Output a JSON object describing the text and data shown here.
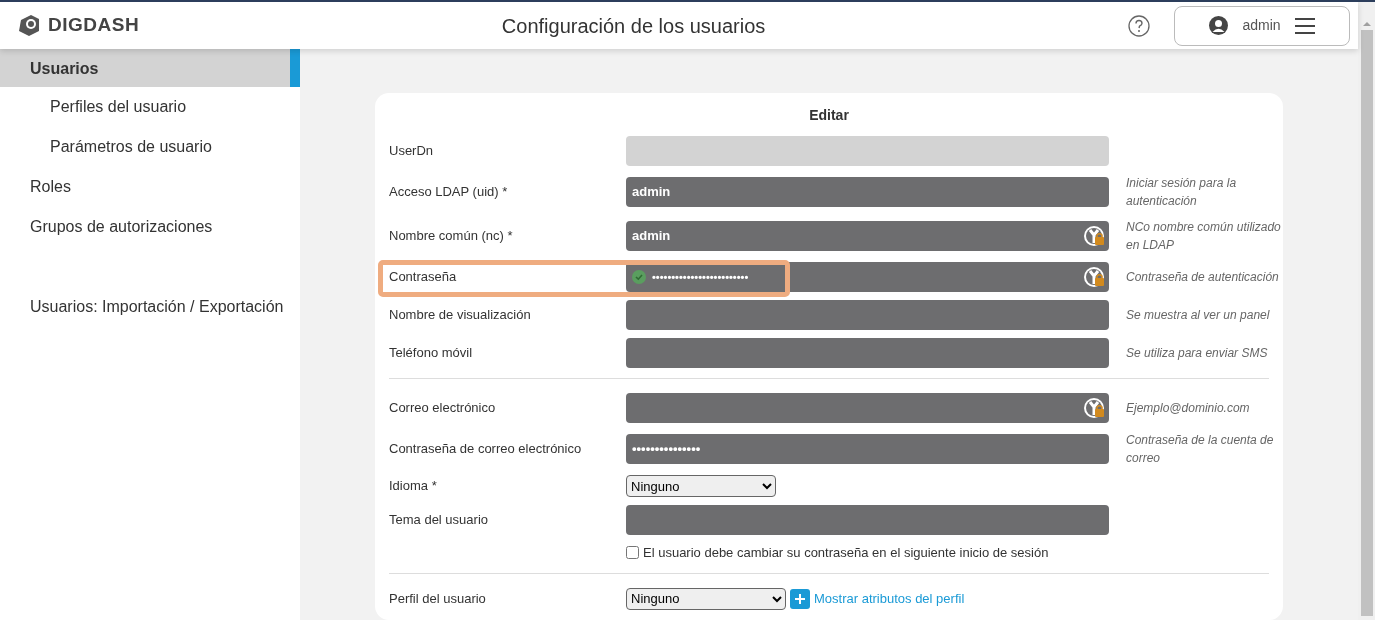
{
  "header": {
    "logo_text": "DIGDASH",
    "title": "Configuración de los usuarios",
    "user": "admin"
  },
  "sidebar": {
    "items": [
      {
        "label": "Usuarios",
        "selected": true,
        "children": [
          {
            "label": "Perfiles del usuario",
            "selected": false
          },
          {
            "label": "Parámetros de usuario",
            "selected": false
          }
        ]
      },
      {
        "label": "Roles",
        "selected": false
      },
      {
        "label": "Grupos de autorizaciones",
        "selected": false
      },
      {
        "label": "Usuarios: Importación / Exportación",
        "selected": false,
        "kind": "separated"
      }
    ]
  },
  "form": {
    "title": "Editar",
    "sections": [
      {
        "fields": [
          {
            "kind": "input",
            "label": "UserDn",
            "disabled": true
          },
          {
            "kind": "input",
            "label": "Acceso LDAP (uid) *",
            "value": "admin",
            "hint": "Iniciar sesión para la autenticación"
          },
          {
            "kind": "input",
            "label": "Nombre común (nc) *",
            "value": "admin",
            "ldap_icon": true,
            "hint": "NCo nombre común utilizado en LDAP"
          },
          {
            "kind": "input",
            "label": "Contraseña",
            "value": "•••••••••••••••••••••••••",
            "valid": true,
            "ldap_icon": true,
            "highlighted": true,
            "hint": "Contraseña de autenticación"
          },
          {
            "kind": "input",
            "label": "Nombre de visualización",
            "hint": "Se muestra al ver un panel"
          },
          {
            "kind": "input",
            "label": "Teléfono móvil",
            "hint": "Se utiliza para enviar SMS"
          }
        ]
      },
      {
        "fields": [
          {
            "kind": "input",
            "label": "Correo electrónico",
            "ldap_icon": true,
            "hint": "Ejemplo@dominio.com"
          },
          {
            "kind": "input",
            "label": "Contraseña de correo electrónico",
            "value": "•••••••••••••••",
            "hint": "Contraseña de la cuenta de correo"
          },
          {
            "kind": "select",
            "label": "Idioma *",
            "value": "Ninguno"
          },
          {
            "kind": "input",
            "label": "Tema del usuario"
          },
          {
            "kind": "checkbox",
            "label": "El usuario debe cambiar su contraseña en el siguiente inicio de sesión",
            "checked": false
          }
        ]
      },
      {
        "fields": [
          {
            "kind": "select_link",
            "label": "Perfil del usuario",
            "value": "Ninguno",
            "link": "Mostrar atributos del perfil"
          }
        ]
      }
    ]
  }
}
